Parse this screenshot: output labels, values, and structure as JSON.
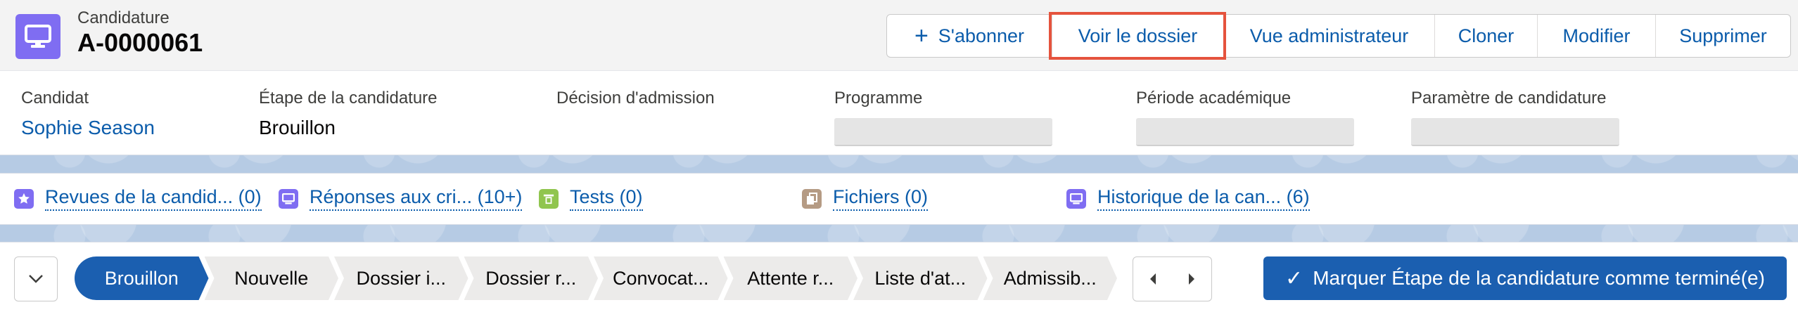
{
  "record": {
    "object_type": "Candidature",
    "name": "A-0000061",
    "icon": "monitor-icon",
    "icon_color": "#7f6df2"
  },
  "actions": [
    {
      "label": "S'abonner",
      "icon": "plus"
    },
    {
      "label": "Voir le dossier",
      "highlighted": true
    },
    {
      "label": "Vue administrateur"
    },
    {
      "label": "Cloner"
    },
    {
      "label": "Modifier"
    },
    {
      "label": "Supprimer"
    }
  ],
  "fields": [
    {
      "label": "Candidat",
      "value": "Sophie Season",
      "link": true
    },
    {
      "label": "Étape de la candidature",
      "value": "Brouillon"
    },
    {
      "label": "Décision d'admission",
      "value": ""
    },
    {
      "label": "Programme",
      "value": ""
    },
    {
      "label": "Période académique",
      "value": ""
    },
    {
      "label": "Paramètre de candidature",
      "value": ""
    }
  ],
  "related_lists": [
    {
      "label": "Revues de la candid... (0)",
      "icon": "star-icon",
      "color": "#7f6df2"
    },
    {
      "label": "Réponses aux cri... (10+)",
      "icon": "monitor-icon",
      "color": "#7f6df2"
    },
    {
      "label": "Tests (0)",
      "icon": "form-icon",
      "color": "#90c54e"
    },
    {
      "label": "Fichiers (0)",
      "icon": "files-icon",
      "color": "#b59b84"
    },
    {
      "label": "Historique de la can... (6)",
      "icon": "monitor-icon",
      "color": "#7f6df2"
    }
  ],
  "path": {
    "stages": [
      "Brouillon",
      "Nouvelle",
      "Dossier i...",
      "Dossier r...",
      "Convocat...",
      "Attente r...",
      "Liste d'at...",
      "Admissib..."
    ],
    "active_index": 0,
    "mark_button_label": "Marquer Étape de la candidature comme terminé(e)"
  },
  "colors": {
    "brand_blue": "#0b5cab",
    "path_active": "#1b5fb0",
    "highlight_outline": "#e5533d"
  }
}
